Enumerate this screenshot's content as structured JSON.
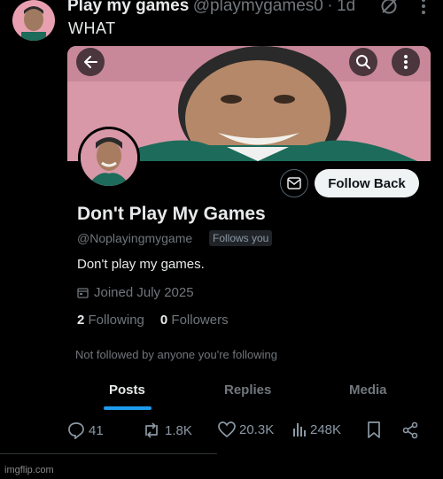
{
  "tweet": {
    "display_name": "Play my games",
    "handle": "@playmygames0",
    "separator": "·",
    "time": "1d",
    "text": "WHAT",
    "icons": {
      "avatar": "avatar",
      "grok": "slashed-circle-icon",
      "more": "more-vertical-icon"
    }
  },
  "profile": {
    "icons": {
      "back": "arrow-left-icon",
      "search": "search-icon",
      "more": "more-vertical-icon",
      "message": "envelope-icon",
      "calendar": "calendar-icon"
    },
    "follow_button_label": "Follow Back",
    "name": "Don't Play My Games",
    "handle": "@Noplayingmygame",
    "follows_you_badge": "Follows you",
    "bio": "Don't play my games.",
    "joined": "Joined July 2025",
    "following_count": "2",
    "following_label": "Following",
    "followers_count": "0",
    "followers_label": "Followers",
    "not_followed_text": "Not followed by anyone you're following",
    "tabs": [
      {
        "label": "Posts",
        "active": true
      },
      {
        "label": "Replies",
        "active": false
      },
      {
        "label": "Media",
        "active": false
      }
    ],
    "colors": {
      "accent": "#1d9bf0",
      "banner": "#d898a8"
    }
  },
  "actions": {
    "replies": "41",
    "reposts": "1.8K",
    "likes": "20.3K",
    "views": "248K",
    "icons": [
      "reply-icon",
      "repost-icon",
      "heart-icon",
      "views-icon",
      "bookmark-icon",
      "share-icon"
    ]
  },
  "watermark": "imgflip.com"
}
